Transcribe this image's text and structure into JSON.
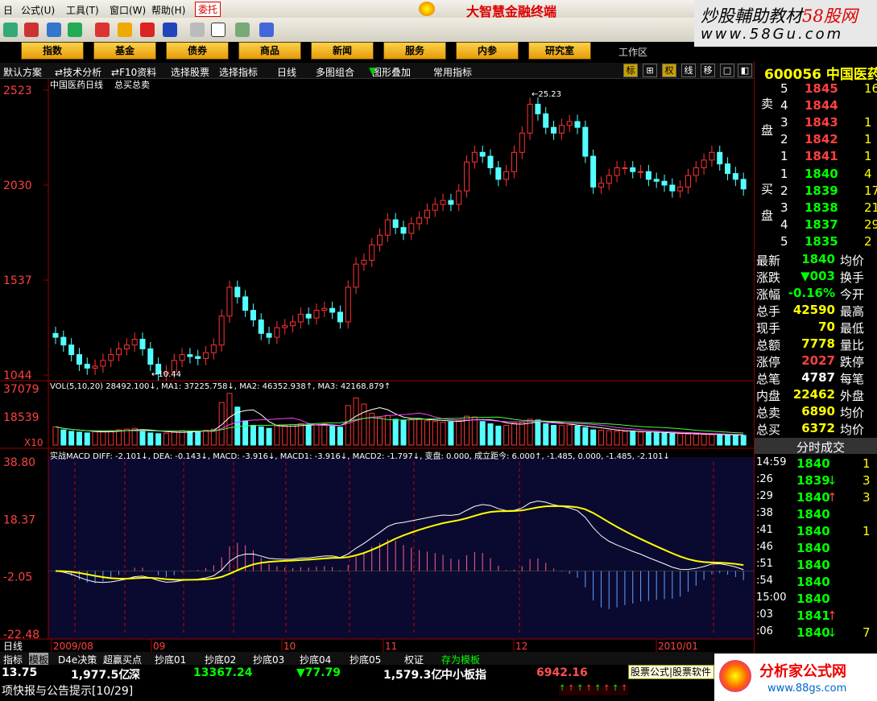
{
  "menu": {
    "items": [
      "公式(U)",
      "工具(T)",
      "窗口(W)",
      "帮助(H)",
      "委托"
    ],
    "brand": "大智慧金融终端"
  },
  "watermark": {
    "line1a": "炒股輔助教材",
    "line1b": "58股网",
    "line2": "www.58Gu.com"
  },
  "tabs": [
    "指数",
    "基金",
    "债券",
    "商品",
    "新闻",
    "服务",
    "内参",
    "研究室"
  ],
  "workspace": "工作区",
  "subbar": {
    "items": [
      "默认方案",
      "技术分析",
      "F10资料",
      "选择股票",
      "选择指标",
      "日线",
      "多图组合",
      "图形叠加",
      "常用指标"
    ],
    "right": [
      "标",
      "⊞",
      "权",
      "线",
      "移",
      "□",
      "◧"
    ]
  },
  "chart": {
    "title": "中国医药日线",
    "title2": "总买总卖",
    "price_labels": [
      "2523",
      "2030",
      "1537",
      "1044"
    ],
    "vol_labels": [
      "37079",
      "18539",
      "X10"
    ],
    "macd_labels": [
      "38.80",
      "18.37",
      "-2.05",
      "-22.48"
    ],
    "max_ann": "25.23",
    "min_ann": "10.44",
    "vol_legend": "VOL(5,10,20) 28492.100↓, MA1: 37225.758↓, MA2: 46352.938↑, MA3: 42168.879↑",
    "macd_legend": "实战MACD DIFF: -2.101↓, DEA: -0.143↓, MACD: -3.916↓, MACD1: -3.916↓, MACD2: -1.797↓, 变盘: 0.000, 成立距今: 6.000↑, -1.485, 0.000, -1.485, -2.101↓",
    "date_labels": [
      "2009/08",
      "09",
      "10",
      "11",
      "12",
      "2010/01"
    ],
    "period": "日线"
  },
  "chart_data": {
    "type": "candlestick",
    "ylim": [
      10.44,
      25.23
    ],
    "y_ticks": [
      25.23,
      20.3,
      15.37,
      10.44
    ],
    "vol_ylim": [
      0,
      37079
    ],
    "macd_ylim": [
      -22.48,
      38.8
    ],
    "closes": [
      12.4,
      12.0,
      11.5,
      11.0,
      10.8,
      10.9,
      11.2,
      11.5,
      11.8,
      12.0,
      12.3,
      11.8,
      11.0,
      10.5,
      10.6,
      11.2,
      11.5,
      11.4,
      11.3,
      11.6,
      12.0,
      13.5,
      15.0,
      14.5,
      13.8,
      13.3,
      12.6,
      12.4,
      12.9,
      13.0,
      13.2,
      13.6,
      13.4,
      13.8,
      13.9,
      13.7,
      13.2,
      15.0,
      16.2,
      16.4,
      17.2,
      17.7,
      18.5,
      18.1,
      17.8,
      18.3,
      18.6,
      19.0,
      19.3,
      19.5,
      19.3,
      20.0,
      21.5,
      22.0,
      21.8,
      21.2,
      20.6,
      21.0,
      22.0,
      23.0,
      24.5,
      24.0,
      23.3,
      23.0,
      23.4,
      23.6,
      23.3,
      21.8,
      20.2,
      20.4,
      20.8,
      21.2,
      21.2,
      21.0,
      21.0,
      20.6,
      20.5,
      20.3,
      20.0,
      20.2,
      20.8,
      21.2,
      21.6,
      22.0,
      21.4,
      20.9,
      20.6,
      20.1
    ],
    "vol": [
      12000,
      10000,
      9000,
      8500,
      8000,
      9000,
      8800,
      9500,
      10000,
      10500,
      11000,
      10000,
      8000,
      7500,
      7800,
      9000,
      9500,
      9000,
      9200,
      9800,
      10500,
      28000,
      34000,
      25000,
      16000,
      13000,
      12000,
      11000,
      12500,
      13000,
      13500,
      14000,
      12800,
      13200,
      13800,
      12500,
      11800,
      26000,
      31000,
      27000,
      21000,
      18000,
      19500,
      17000,
      16500,
      17000,
      17500,
      16000,
      15500,
      15000,
      15200,
      16000,
      19000,
      18500,
      15500,
      14000,
      12500,
      13000,
      14500,
      15000,
      17000,
      16500,
      14000,
      13000,
      12800,
      13200,
      12500,
      11500,
      10000,
      9800,
      9500,
      9200,
      9000,
      8800,
      8500,
      8200,
      8000,
      7800,
      7600,
      7500,
      7300,
      7100,
      7000,
      6800,
      6700,
      6600,
      6500,
      6400
    ]
  },
  "quote": {
    "code": "600056",
    "name": "中国医药",
    "sell_label": "卖盘",
    "buy_label": "买盘",
    "sell": [
      {
        "lv": "5",
        "price": "1845",
        "vol": "16"
      },
      {
        "lv": "4",
        "price": "1844",
        "vol": ""
      },
      {
        "lv": "3",
        "price": "1843",
        "vol": "1"
      },
      {
        "lv": "2",
        "price": "1842",
        "vol": "1"
      },
      {
        "lv": "1",
        "price": "1841",
        "vol": "1"
      }
    ],
    "buy": [
      {
        "lv": "1",
        "price": "1840",
        "vol": "4"
      },
      {
        "lv": "2",
        "price": "1839",
        "vol": "17"
      },
      {
        "lv": "3",
        "price": "1838",
        "vol": "21"
      },
      {
        "lv": "4",
        "price": "1837",
        "vol": "29"
      },
      {
        "lv": "5",
        "price": "1835",
        "vol": "2"
      }
    ],
    "info": [
      {
        "k": "最新",
        "v": "1840",
        "k2": "均价"
      },
      {
        "k": "涨跌",
        "v": "▼003",
        "k2": "换手"
      },
      {
        "k": "涨幅",
        "v": "-0.16%",
        "k2": "今开"
      },
      {
        "k": "总手",
        "v": "42590",
        "k2": "最高"
      },
      {
        "k": "现手",
        "v": "70",
        "k2": "最低"
      },
      {
        "k": "总额",
        "v": "7778",
        "k2": "量比"
      },
      {
        "k": "涨停",
        "v": "2027",
        "k2": "跌停"
      },
      {
        "k": "总笔",
        "v": "4787",
        "k2": "每笔"
      },
      {
        "k": "内盘",
        "v": "22462",
        "k2": "外盘"
      },
      {
        "k": "总卖",
        "v": "6890",
        "k2": "均价"
      },
      {
        "k": "总买",
        "v": "6372",
        "k2": "均价"
      }
    ],
    "ticks_title": "分时成交",
    "ticks": [
      {
        "t": "14:59",
        "p": "1840",
        "a": "",
        "v": "1"
      },
      {
        "t": ":26",
        "p": "1839",
        "a": "↓",
        "v": "3"
      },
      {
        "t": ":29",
        "p": "1840",
        "a": "↑",
        "v": "3"
      },
      {
        "t": ":38",
        "p": "1840",
        "a": "",
        "v": ""
      },
      {
        "t": ":41",
        "p": "1840",
        "a": "",
        "v": "1"
      },
      {
        "t": ":46",
        "p": "1840",
        "a": "",
        "v": ""
      },
      {
        "t": ":51",
        "p": "1840",
        "a": "",
        "v": ""
      },
      {
        "t": ":54",
        "p": "1840",
        "a": "",
        "v": ""
      },
      {
        "t": "15:00",
        "p": "1840",
        "a": "",
        "v": ""
      },
      {
        "t": ":03",
        "p": "1841",
        "a": "↑",
        "v": ""
      },
      {
        "t": ":06",
        "p": "1840",
        "a": "↓",
        "v": "7"
      }
    ]
  },
  "bottom_tabs": [
    "指标",
    "模板",
    "D4e决策",
    "超赢买点",
    "抄底01",
    "抄底02",
    "抄底03",
    "抄底04",
    "抄底05",
    "权证",
    "存为模板"
  ],
  "status": {
    "s1": "13.75",
    "s2": "1,977.5亿",
    "s3": "深",
    "s4": "13367.24",
    "s5": "▼77.79",
    "s6": "1,579.3亿",
    "s7": "中小板指",
    "s8": "6942.16",
    "news": "项快报与公告提示[10/29]"
  },
  "ads": {
    "a1": "股票公式|股票软件",
    "a2": "分析家公式网",
    "a3": "www.88gs.com"
  },
  "colors": {
    "up": "#ff3232",
    "down": "#54ffff",
    "yellow": "#ffff00",
    "gold": "#e8a000",
    "green": "#00e000"
  }
}
